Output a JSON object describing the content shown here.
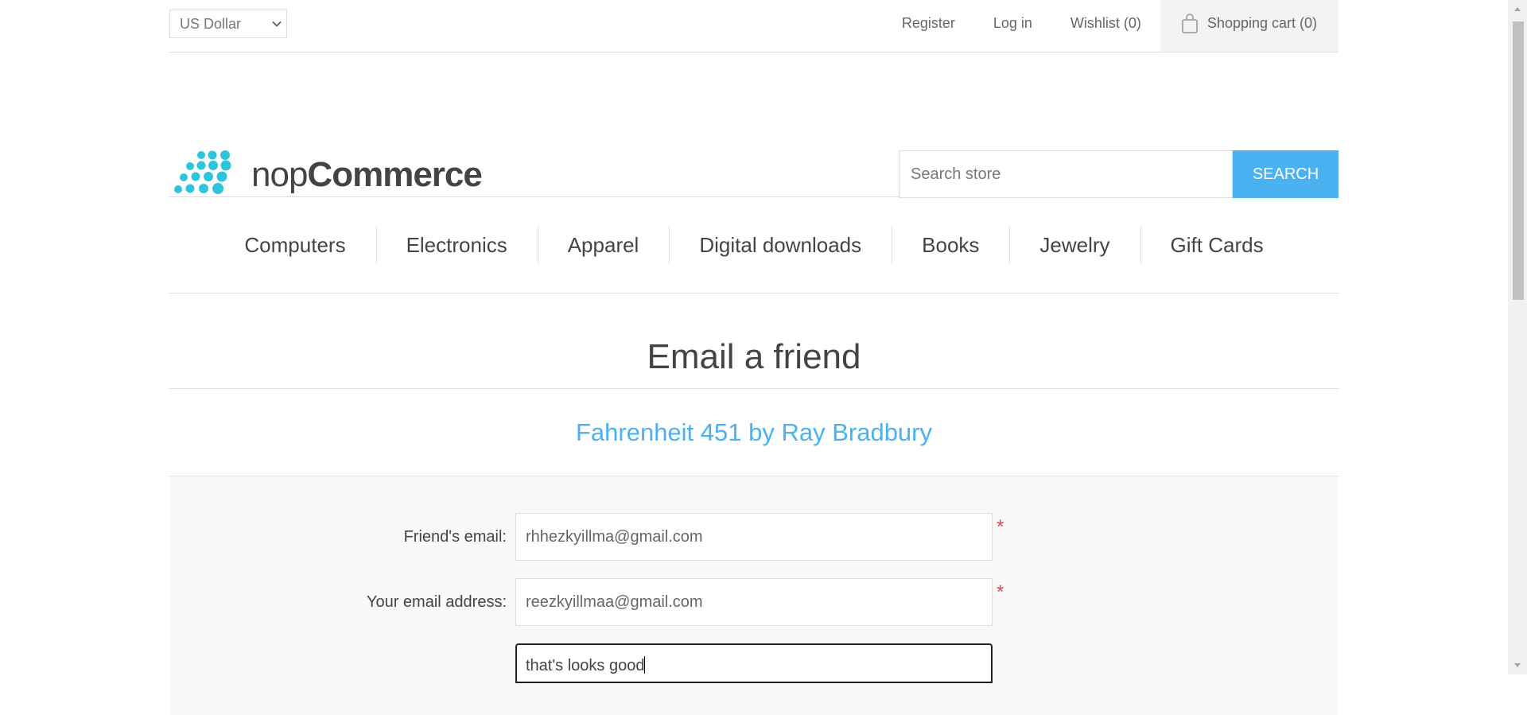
{
  "header": {
    "currency": "US Dollar",
    "links": {
      "register": "Register",
      "login": "Log in",
      "wishlist": "Wishlist (0)",
      "cart": "Shopping cart (0)"
    }
  },
  "logo": {
    "light": "nop",
    "bold": "Commerce"
  },
  "search": {
    "placeholder": "Search store",
    "button": "SEARCH"
  },
  "menu": [
    "Computers",
    "Electronics",
    "Apparel",
    "Digital downloads",
    "Books",
    "Jewelry",
    "Gift Cards"
  ],
  "page": {
    "title": "Email a friend",
    "product": "Fahrenheit 451 by Ray Bradbury"
  },
  "form": {
    "friend_email": {
      "label": "Friend's email:",
      "value": "rhhezkyillma@gmail.com",
      "required": "*"
    },
    "your_email": {
      "label": "Your email address:",
      "value": "reezkyillmaa@gmail.com",
      "required": "*"
    },
    "message": {
      "value": "that's looks good"
    }
  },
  "colors": {
    "accent": "#4ab2f1",
    "required": "#e4444c",
    "text": "#444444"
  }
}
